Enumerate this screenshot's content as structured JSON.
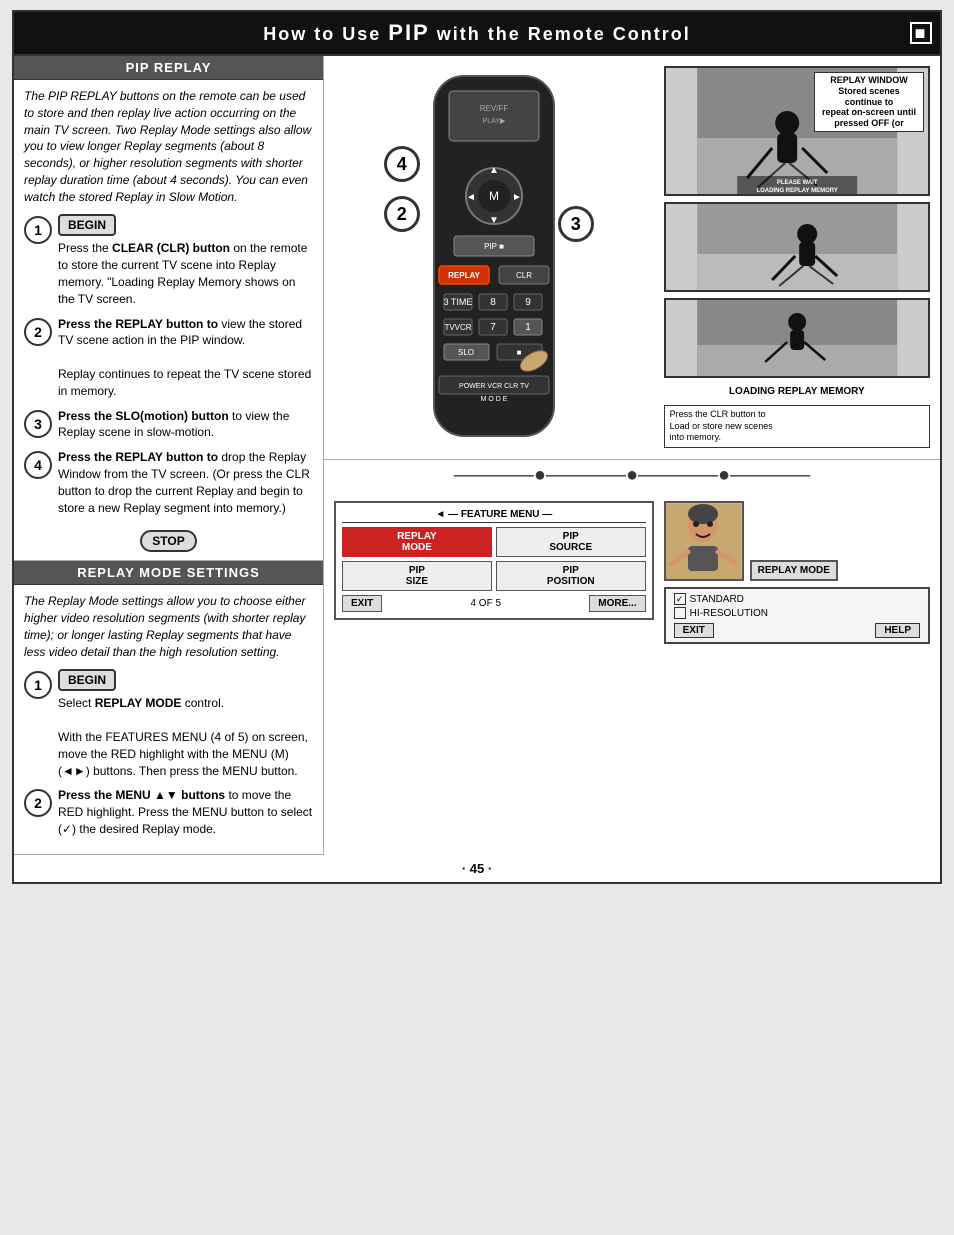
{
  "header": {
    "title_prefix": "How to Use ",
    "title_pip": "PIP",
    "title_suffix": " with the Remote Control",
    "corner": "■"
  },
  "pip_replay": {
    "section_title": "PIP REPLAY",
    "intro": "The PIP REPLAY buttons on the remote can be used to store and then replay live action occurring on the main TV screen. Two Replay Mode settings also allow you to view longer Replay segments (about 8 seconds), or higher resolution segments with shorter replay duration time (about 4 seconds). You can even watch the stored Replay in Slow Motion.",
    "begin_label": "BEGIN",
    "stop_label": "STOP",
    "steps": [
      {
        "num": "1",
        "text_parts": [
          "Press the ",
          "CLEAR (CLR)",
          " button on the remote to store the current TV scene into Replay memory. \"Loading Replay Memory shows on the TV screen."
        ]
      },
      {
        "num": "2",
        "text_parts": [
          "Press the ",
          "REPLAY button",
          " to view the stored TV scene action in the PIP window.",
          "\nReplay continues to repeat the TV scene stored in memory."
        ]
      },
      {
        "num": "3",
        "text_parts": [
          "Press the ",
          "SLO(motion) button",
          " to view the Replay scene in slow-motion."
        ]
      },
      {
        "num": "4",
        "text_parts": [
          "Press the ",
          "REPLAY button",
          " to drop the Replay Window from the TV screen. (Or press the CLR button to drop the current Replay and begin to store a new Replay segment into memory.)"
        ]
      }
    ]
  },
  "replay_mode": {
    "section_title": "REPLAY MODE SETTINGS",
    "intro": "The Replay Mode settings allow you to choose either higher video resolution segments (with shorter replay time); or longer lasting Replay segments that have less video detail than the high resolution setting.",
    "begin_label": "BEGIN",
    "steps": [
      {
        "num": "1",
        "text_parts": [
          "Select ",
          "REPLAY MODE",
          " control.",
          "\nWith the FEATURES MENU (4 of 5) on screen, move the RED highlight with the MENU (M) (◄►) buttons. Then press the MENU button."
        ]
      },
      {
        "num": "2",
        "text_parts": [
          "Press the ",
          "MENU ▲▼ buttons",
          " to move the RED highlight. Press the MENU button to select (✓) the desired Replay mode."
        ]
      }
    ]
  },
  "scenes": {
    "replay_window_label": "REPLAY WINDOW\nStored scenes continue to\nrepeat on-screen until\npressed OFF (or",
    "please_wait": "PLEASE WAIT\nLOADING REPLAY MEMORY",
    "loading_label": "LOADING REPLAY MEMORY",
    "clr_note": "Press the CLR button to\nLoad or store new scenes\ninto memory."
  },
  "feature_menu": {
    "title": "FEATURE MENU",
    "buttons": [
      {
        "label": "REPLAY\nMODE",
        "active": true
      },
      {
        "label": "PIP\nSOURCE",
        "active": false
      },
      {
        "label": "PIP\nSIZE",
        "active": false
      },
      {
        "label": "PIP\nPOSITION",
        "active": false
      },
      {
        "label": "EXIT",
        "active": false
      },
      {
        "label": "MORE...",
        "active": false
      }
    ],
    "page_indicator": "4 OF 5"
  },
  "replay_mode_dialog": {
    "title": "REPLAY MODE",
    "options": [
      {
        "label": "STANDARD",
        "checked": true
      },
      {
        "label": "HI-RESOLUTION",
        "checked": false
      }
    ],
    "exit_label": "EXIT",
    "help_label": "HELP"
  },
  "page_number": "45",
  "badge_numbers": [
    "4",
    "2",
    "3"
  ]
}
